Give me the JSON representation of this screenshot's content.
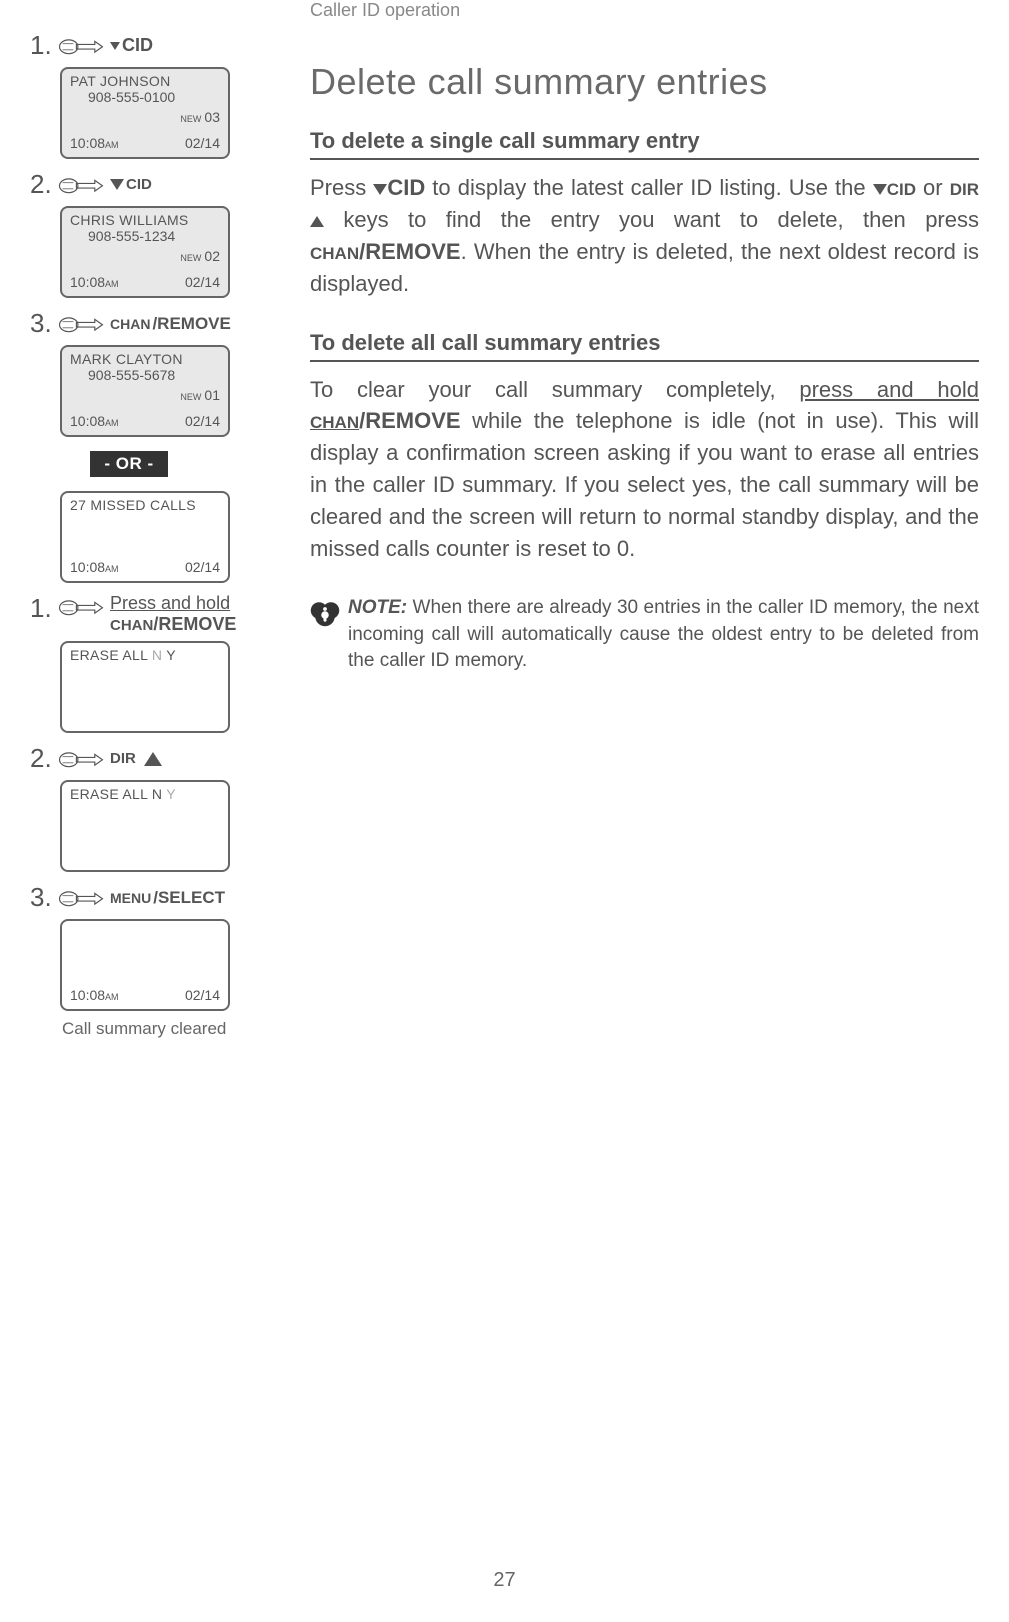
{
  "header": "Caller ID operation",
  "title": "Delete call summary entries",
  "section1": {
    "heading": "To delete a single call summary entry",
    "body_pre": "Press ",
    "body_cid": "CID",
    "body_mid1": " to display the latest caller ID listing. Use the ",
    "body_cid2": "CID",
    "body_or": " or ",
    "body_dir": "DIR",
    "body_mid2": " keys to find the entry you want to delete, then press ",
    "body_chan": "CHAN",
    "body_remove": "/REMOVE",
    "body_end": ". When the entry is deleted, the next oldest record is displayed."
  },
  "section2": {
    "heading": "To delete all call summary entries",
    "body_pre": "To clear your call summary completely, ",
    "body_press_hold": "press and hold",
    "body_sp": " ",
    "body_chan": "CHAN",
    "body_remove": "/REMOVE",
    "body_end": " while the telephone is idle (not in use). This will display a confirmation screen asking if you want to erase all entries in the caller ID summary. If you select yes, the call summary will be cleared and the screen will return to normal standby display, and the missed calls counter is reset to 0."
  },
  "note": {
    "label": "NOTE:",
    "text": " When there are already 30 entries in the caller ID memory, the next incoming call will automatically cause the oldest entry to be deleted from the caller ID memory."
  },
  "left": {
    "steps_a": [
      {
        "num": "1.",
        "label_cid": "CID",
        "lcd": {
          "name": "PAT JOHNSON",
          "phone": "908-555-0100",
          "new": "NEW",
          "count": "03",
          "time": "10:08",
          "ampm": "AM",
          "date": "02/14"
        }
      },
      {
        "num": "2.",
        "label_cid": "CID",
        "lcd": {
          "name": "CHRIS WILLIAMS",
          "phone": "908-555-1234",
          "new": "NEW",
          "count": "02",
          "time": "10:08",
          "ampm": "AM",
          "date": "02/14"
        }
      },
      {
        "num": "3.",
        "label_chan": "CHAN",
        "label_remove": "/REMOVE",
        "lcd": {
          "name": "MARK CLAYTON",
          "phone": "908-555-5678",
          "new": "NEW",
          "count": "01",
          "time": "10:08",
          "ampm": "AM",
          "date": "02/14"
        }
      }
    ],
    "or": "- OR -",
    "missed_lcd": {
      "text": "27 MISSED CALLS",
      "time": "10:08",
      "ampm": "AM",
      "date": "02/14"
    },
    "steps_b": [
      {
        "num": "1.",
        "label_press": "Press and hold",
        "label_chan": "CHAN",
        "label_remove": "/REMOVE",
        "lcd": {
          "prefix": "ERASE ALL ",
          "n": "N",
          "sp": " ",
          "y": "Y"
        }
      },
      {
        "num": "2.",
        "label_dir": "DIR",
        "lcd": {
          "prefix": "ERASE ALL N ",
          "y": "Y"
        }
      },
      {
        "num": "3.",
        "label_menu": "MENU",
        "label_select": "/SELECT",
        "lcd": {
          "time": "10:08",
          "ampm": "AM",
          "date": "02/14"
        }
      }
    ],
    "caption": "Call summary cleared"
  },
  "page_number": "27"
}
